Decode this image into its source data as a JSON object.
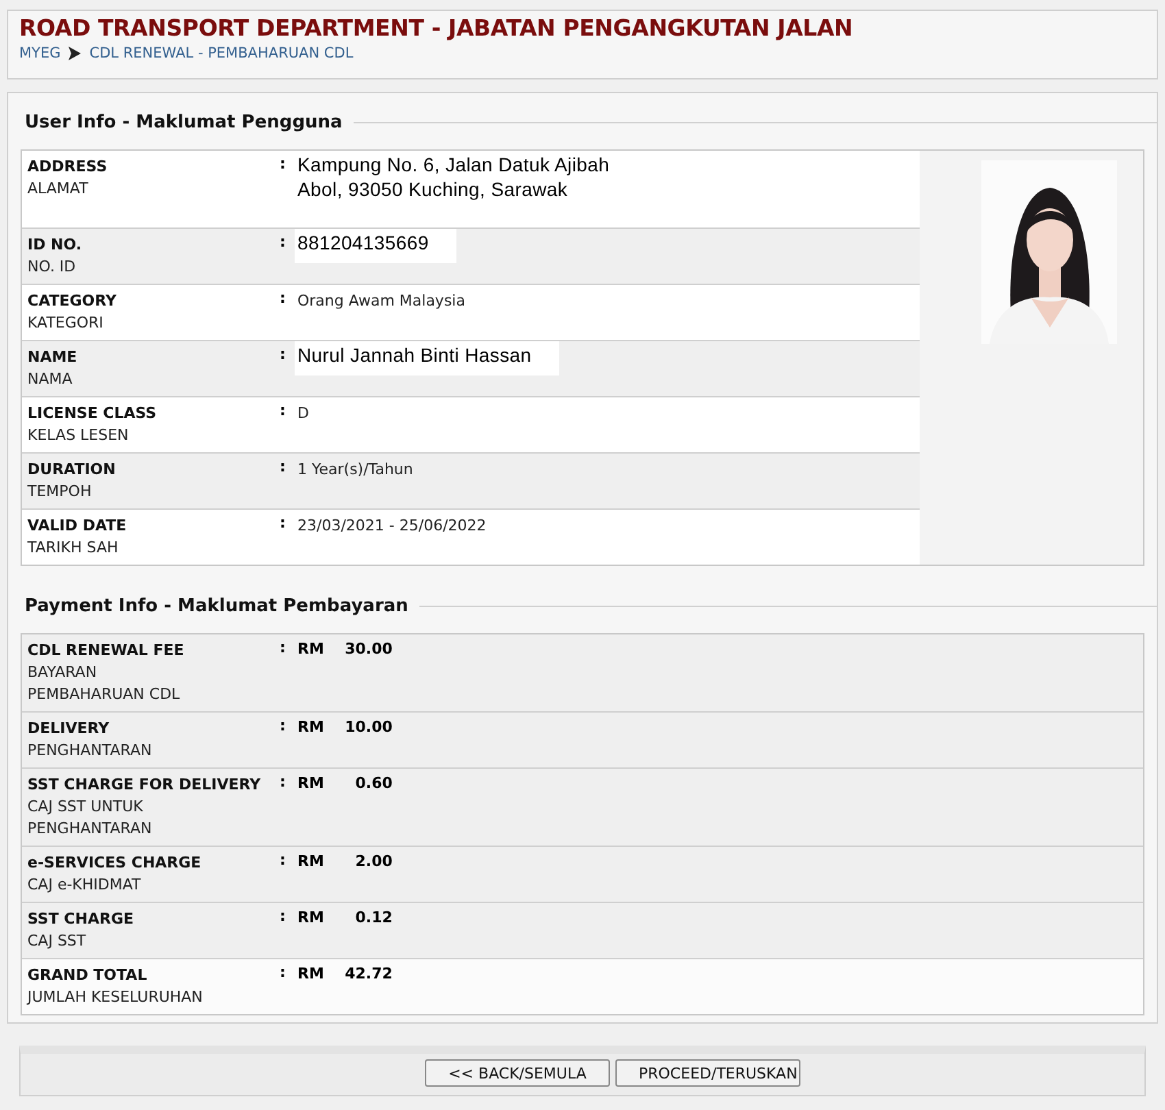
{
  "header": {
    "title": "ROAD TRANSPORT DEPARTMENT - JABATAN PENGANGKUTAN JALAN",
    "breadcrumb": [
      {
        "label": "MYEG"
      },
      {
        "label": "CDL RENEWAL - PEMBAHARUAN CDL"
      }
    ]
  },
  "user_info": {
    "legend": "User Info - Maklumat Pengguna",
    "rows": [
      {
        "label": "ADDRESS",
        "sublabel": "ALAMAT",
        "separator": ":",
        "value_lines": [
          "Kampung No. 6, Jalan Datuk Ajibah",
          "Abol, 93050 Kuching, Sarawak"
        ],
        "kind": "pasted"
      },
      {
        "label": "ID NO.",
        "sublabel": "NO. ID",
        "separator": ":",
        "value_lines": [
          "881204135669"
        ],
        "kind": "pasted"
      },
      {
        "label": "CATEGORY",
        "sublabel": "KATEGORI",
        "separator": ":",
        "value_lines": [
          "Orang Awam Malaysia"
        ],
        "kind": "plain"
      },
      {
        "label": "NAME",
        "sublabel": "NAMA",
        "separator": ":",
        "value_lines": [
          "Nurul Jannah Binti Hassan"
        ],
        "kind": "pasted"
      },
      {
        "label": "LICENSE CLASS",
        "sublabel": "KELAS LESEN",
        "separator": ":",
        "value_lines": [
          "D"
        ],
        "kind": "plain"
      },
      {
        "label": "DURATION",
        "sublabel": "TEMPOH",
        "separator": ":",
        "value_lines": [
          "1 Year(s)/Tahun"
        ],
        "kind": "plain"
      },
      {
        "label": "VALID DATE",
        "sublabel": "TARIKH SAH",
        "separator": ":",
        "value_lines": [
          "23/03/2021 - 25/06/2022"
        ],
        "kind": "plain"
      }
    ]
  },
  "payment_info": {
    "legend": "Payment Info - Maklumat Pembayaran",
    "rows": [
      {
        "label": "CDL RENEWAL FEE",
        "sublabel": "BAYARAN PEMBAHARUAN CDL",
        "separator": ":",
        "currency": "RM",
        "amount": "30.00",
        "kind": "item"
      },
      {
        "label": "DELIVERY",
        "sublabel": "PENGHANTARAN",
        "separator": ":",
        "currency": "RM",
        "amount": "10.00",
        "kind": "item"
      },
      {
        "label": "SST CHARGE FOR DELIVERY",
        "sublabel": "CAJ SST UNTUK PENGHANTARAN",
        "separator": ":",
        "currency": "RM",
        "amount": "0.60",
        "kind": "item"
      },
      {
        "label": "e-SERVICES CHARGE",
        "sublabel": "CAJ e-KHIDMAT",
        "separator": ":",
        "currency": "RM",
        "amount": "2.00",
        "kind": "item"
      },
      {
        "label": "SST CHARGE",
        "sublabel": "CAJ SST",
        "separator": ":",
        "currency": "RM",
        "amount": "0.12",
        "kind": "item"
      },
      {
        "label": "GRAND TOTAL",
        "sublabel": "JUMLAH KESELURUHAN",
        "separator": ":",
        "currency": "RM",
        "amount": "42.72",
        "kind": "total"
      }
    ]
  },
  "buttons": [
    {
      "label": "<< BACK/SEMULA"
    },
    {
      "label": "PROCEED/TERUSKAN"
    }
  ]
}
